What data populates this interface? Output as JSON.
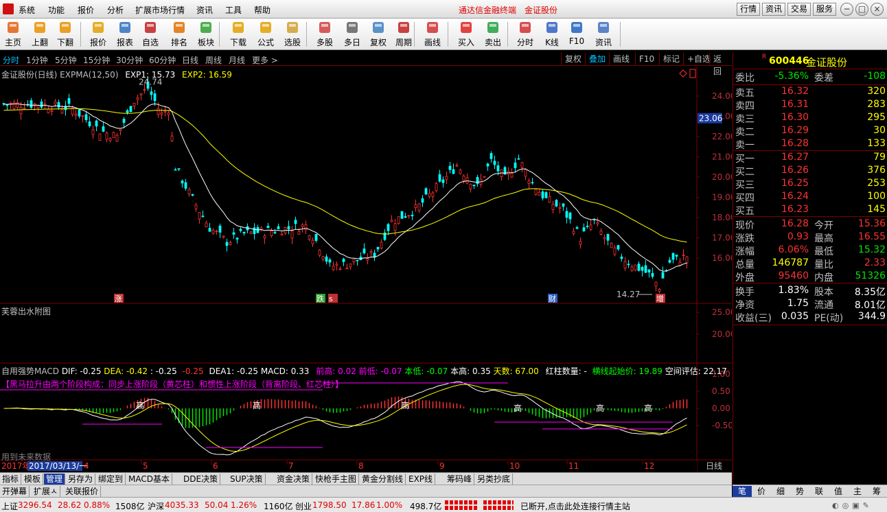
{
  "menubar": {
    "items": [
      "系统",
      "功能",
      "报价",
      "分析",
      "扩展市场行情",
      "资讯",
      "工具",
      "帮助"
    ],
    "title": "通达信金融终端",
    "stock_title": "金证股份",
    "right_buttons": [
      "行情",
      "资讯",
      "交易",
      "服务"
    ]
  },
  "toolbar": {
    "buttons": [
      {
        "label": "主页",
        "icon": "home-icon"
      },
      {
        "label": "上翻",
        "icon": "arrow-up-icon"
      },
      {
        "label": "下翻",
        "icon": "arrow-down-icon"
      },
      {
        "label": "报价",
        "icon": "yen-icon"
      },
      {
        "label": "报表",
        "icon": "report-icon"
      },
      {
        "label": "自选",
        "icon": "f6-icon"
      },
      {
        "label": "排名",
        "icon": "ranking-icon"
      },
      {
        "label": "板块",
        "icon": "blocks-icon"
      },
      {
        "label": "下载",
        "icon": "download-icon"
      },
      {
        "label": "公式",
        "icon": "formula-icon"
      },
      {
        "label": "选股",
        "icon": "stock-pick-icon"
      },
      {
        "label": "多股",
        "icon": "multi-stock-icon"
      },
      {
        "label": "多日",
        "icon": "clock-icon"
      },
      {
        "label": "复权",
        "icon": "restore-icon"
      },
      {
        "label": "周期",
        "icon": "f8-icon"
      },
      {
        "label": "画线",
        "icon": "draw-icon"
      },
      {
        "label": "买入",
        "icon": "buy-icon"
      },
      {
        "label": "卖出",
        "icon": "sell-icon"
      },
      {
        "label": "分时",
        "icon": "timeshare-icon"
      },
      {
        "label": "K线",
        "icon": "kline-icon"
      },
      {
        "label": "F10",
        "icon": "f10-icon"
      },
      {
        "label": "资讯",
        "icon": "news-icon"
      }
    ]
  },
  "periods": [
    "分时",
    "1分钟",
    "5分钟",
    "15分钟",
    "30分钟",
    "60分钟",
    "日线",
    "周线",
    "月线",
    "更多 >"
  ],
  "period_right": [
    "复权",
    "叠加",
    "画线",
    "F10",
    "标记",
    "+自选",
    "返回"
  ],
  "main_chart": {
    "label": "金证股份(日线) EXPMA(12,50)",
    "exp1": "EXP1: 15.73",
    "exp2": "EXP2: 16.59",
    "high_label": "24.74",
    "low_label": "14.27",
    "price_ticks": [
      "24.00",
      "23.00",
      "22.00",
      "21.00",
      "20.00",
      "19.00",
      "18.00",
      "17.00",
      "16.00"
    ],
    "current_price_tag": "23.06",
    "markers": [
      "涨",
      "跌",
      "s",
      "财",
      "增"
    ]
  },
  "sub_chart1": {
    "label": "芙蓉出水附图",
    "ticks": [
      "25.00",
      "20.00"
    ]
  },
  "sub_chart2": {
    "title": "自用强势MACD",
    "dif": "DIF: -0.25",
    "dea": "DEA: -0.42",
    "v3": ": -0.25",
    "v4": "-0.25",
    "dea1": "DEA1: -0.25",
    "macd": "MACD: 0.33",
    "qiangao": "前高: 0.02",
    "qiandi": "前低: -0.07",
    "bendi": "本低: -0.07",
    "bengao": "本高: 0.35",
    "tianshu": "天数: 67.00",
    "hongzhu": "红柱数量: -",
    "hengxian": "横线起始价: 19.89",
    "kongjian": "空间评估: 22.17",
    "note": "【黑马拉升由两个阶段构成：同步上涨阶段（黄芯柱）和惯性上涨阶段（背离阶段、红芯柱）】",
    "future": "用到未来数据",
    "ticks": [
      "1.00",
      "0.50",
      "0.00",
      "-0.50"
    ],
    "gao": "高",
    "gao_labels": [
      "高",
      "高",
      "高",
      "高",
      "高",
      "高"
    ]
  },
  "time_axis": {
    "year": "2017年",
    "cursor_date": "2017/03/13/一",
    "months": [
      "4",
      "5",
      "6",
      "7",
      "8",
      "9",
      "10",
      "11",
      "12"
    ],
    "period_btn": "日线"
  },
  "bottom_tabs": [
    "指标",
    "模板",
    "管理",
    "另存为",
    "绑定到",
    "MACD基本",
    "DDE决策",
    "SUP决策",
    "资金决策",
    "快枪手主图",
    "黄金分割线",
    "EXP线",
    "筹码峰",
    "另类抄底"
  ],
  "bottom_tabs2": [
    "开弹幕",
    "扩展ㅅ",
    "关联报价"
  ],
  "right_tabs": [
    "笔",
    "价",
    "细",
    "势",
    "联",
    "值",
    "主",
    "筹"
  ],
  "quote": {
    "flag": "R",
    "code": "600446",
    "name": "金证股份",
    "weibi_label": "委比",
    "weibi": "-5.36%",
    "weicha_label": "委差",
    "weicha": "-108",
    "asks": [
      {
        "name": "卖五",
        "price": "16.32",
        "vol": "320"
      },
      {
        "name": "卖四",
        "price": "16.31",
        "vol": "283"
      },
      {
        "name": "卖三",
        "price": "16.30",
        "vol": "295"
      },
      {
        "name": "卖二",
        "price": "16.29",
        "vol": "30"
      },
      {
        "name": "卖一",
        "price": "16.28",
        "vol": "133"
      }
    ],
    "bids": [
      {
        "name": "买一",
        "price": "16.27",
        "vol": "79"
      },
      {
        "name": "买二",
        "price": "16.26",
        "vol": "376"
      },
      {
        "name": "买三",
        "price": "16.25",
        "vol": "253"
      },
      {
        "name": "买四",
        "price": "16.24",
        "vol": "100"
      },
      {
        "name": "买五",
        "price": "16.23",
        "vol": "145"
      }
    ],
    "stats": [
      {
        "l1": "现价",
        "v1": "16.28",
        "c1": "#ff3232",
        "l2": "今开",
        "v2": "15.36",
        "c2": "#ff3232"
      },
      {
        "l1": "涨跌",
        "v1": "0.93",
        "c1": "#ff3232",
        "l2": "最高",
        "v2": "16.55",
        "c2": "#ff3232"
      },
      {
        "l1": "涨幅",
        "v1": "6.06%",
        "c1": "#ff3232",
        "l2": "最低",
        "v2": "15.32",
        "c2": "#00e600"
      },
      {
        "l1": "总量",
        "v1": "146787",
        "c1": "#ffff00",
        "l2": "量比",
        "v2": "2.33",
        "c2": "#ff3232"
      },
      {
        "l1": "外盘",
        "v1": "95460",
        "c1": "#ff3232",
        "l2": "内盘",
        "v2": "51326",
        "c2": "#00e600"
      }
    ],
    "stats2": [
      {
        "l1": "换手",
        "v1": "1.83%",
        "l2": "股本",
        "v2": "8.35亿"
      },
      {
        "l1": "净资",
        "v1": "1.75",
        "l2": "流通",
        "v2": "8.01亿"
      },
      {
        "l1": "收益(三)",
        "v1": "0.035",
        "l2": "PE(动)",
        "v2": "344.9"
      }
    ]
  },
  "status": {
    "sh_label": "上证",
    "sh_val": "3296.54",
    "sh_chg": "28.62",
    "sh_pct": "0.88%",
    "sh_amt": "1508亿",
    "sz_label": "沪深",
    "sz_val": "4035.33",
    "sz_chg": "50.04",
    "sz_pct": "1.26%",
    "sz_amt": "1160亿",
    "cy_label": "创业",
    "cy_val": "1798.50",
    "cy_chg": "17.86",
    "cy_pct": "1.00%",
    "cy_amt": "498.7亿",
    "msg": "已断开,点击此处连接行情主站"
  },
  "colors": {
    "up": "#ff3232",
    "down": "#00ffff",
    "ma1": "#ffffff",
    "ma2": "#ffff00",
    "border": "#7a0000"
  }
}
